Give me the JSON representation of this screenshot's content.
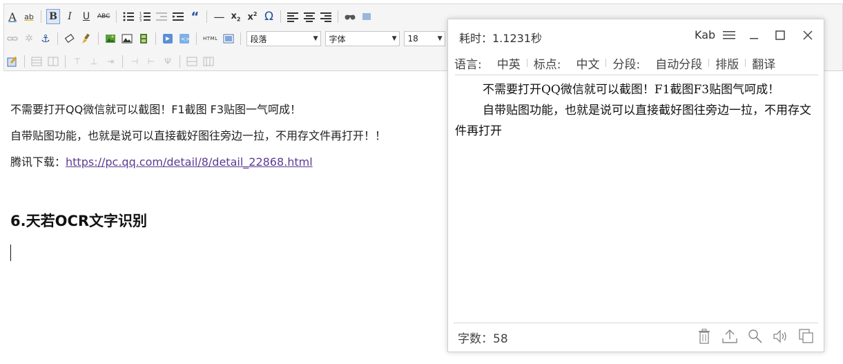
{
  "toolbar": {
    "paragraph_select": "段落",
    "font_select": "字体",
    "size_select": "18"
  },
  "editor": {
    "lines": [
      "不需要打开QQ微信就可以截图！F1截图  F3贴图一气呵成！",
      "自带贴图功能，也就是说可以直接截好图往旁边一拉，不用存文件再打开！！"
    ],
    "download_label": "腾讯下载：",
    "download_link": "https://pc.qq.com/detail/8/detail_22868.html",
    "heading": "6.天若OCR文字识别"
  },
  "ocr_window": {
    "time_label": "耗时：1.1231秒",
    "brand": "Kab",
    "menu": [
      "语言:",
      "中英",
      "标点:",
      "中文",
      "分段:",
      "自动分段",
      "排版",
      "翻译"
    ],
    "paragraphs": [
      "不需要打开QQ微信就可以截图！F1截图F3贴图气呵成！",
      "自带贴图功能，也就是说可以直接截好图往旁边一拉，不用存文件再打开"
    ],
    "word_count": "字数：58"
  },
  "colors": {
    "link": "#5b3a91",
    "toolbar_bg": "#f5f5f5",
    "active_button_bg": "#dbe6f7"
  }
}
